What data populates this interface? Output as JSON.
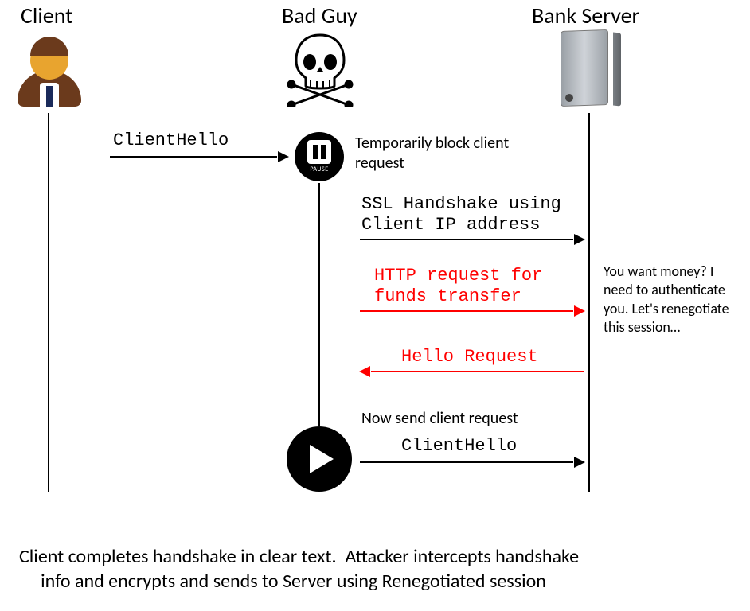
{
  "actors": {
    "client": "Client",
    "attacker": "Bad Guy",
    "server": "Bank Server"
  },
  "icons": {
    "pause_text": "PAUSE"
  },
  "messages": {
    "client_hello_1": "ClientHello",
    "block_note": "Temporarily block\nclient request",
    "ssl_handshake": "SSL Handshake using\nClient IP address",
    "http_req": "HTTP request for\nfunds transfer",
    "hello_request": "Hello Request",
    "now_send": "Now send client request",
    "client_hello_2": "ClientHello"
  },
  "server_thought": "You want money?  I need to authenticate you.  Let's renegotiate this session…",
  "footer": "Client completes handshake in clear text.  Attacker intercepts handshake\n     info and encrypts and sends to Server using Renegotiated session"
}
